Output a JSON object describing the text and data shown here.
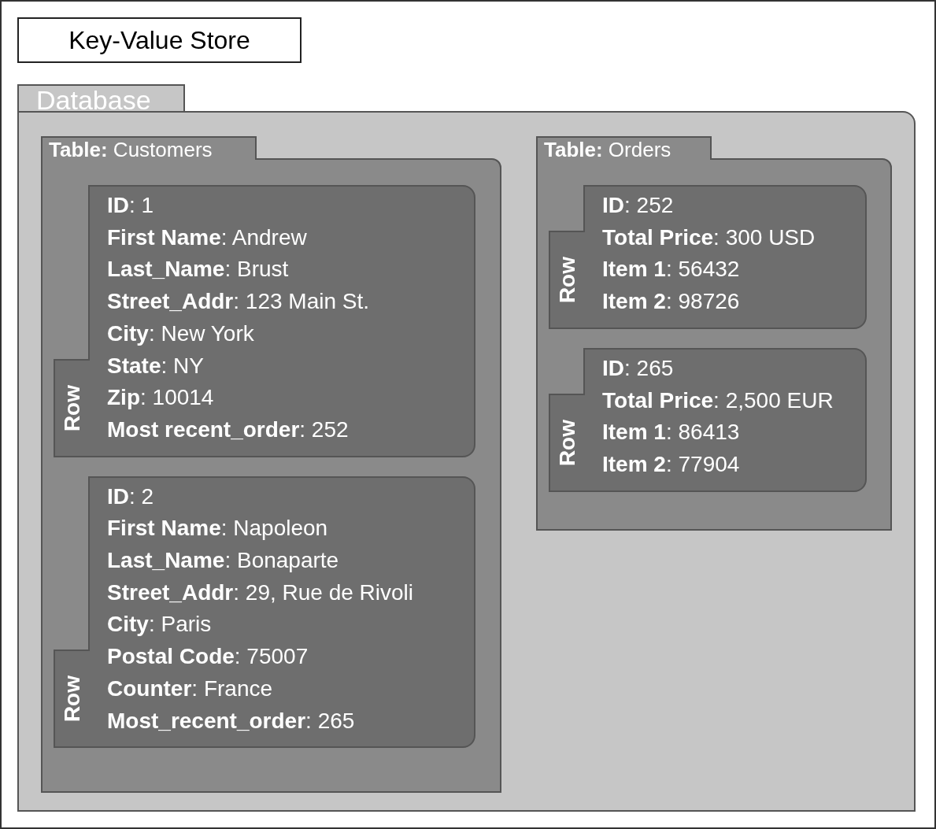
{
  "title": "Key-Value Store",
  "database": {
    "label": "Database",
    "tables": [
      {
        "label": "**Table:** Customers",
        "rows": [
          {
            "tab": "Row",
            "fields": [
              "**ID**: 1",
              "**First Name**: Andrew",
              "**Last_Name**: Brust",
              "**Street_Addr**: 123 Main St.",
              "**City**: New York",
              "**State**: NY",
              "**Zip**: 10014",
              "**Most recent_order**: 252"
            ]
          },
          {
            "tab": "Row",
            "fields": [
              "**ID**: 2",
              "**First Name**: Napoleon",
              "**Last_Name**: Bonaparte",
              "**Street_Addr**: 29, Rue de Rivoli",
              "**City**: Paris",
              "**Postal Code**: 75007",
              "**Counter**: France",
              "**Most_recent_order**: 265"
            ]
          }
        ]
      },
      {
        "label": "**Table:** Orders",
        "rows": [
          {
            "tab": "Row",
            "fields": [
              "**ID**: 252",
              "**Total Price**: 300 USD",
              "**Item 1**: 56432",
              "**Item 2**: 98726"
            ]
          },
          {
            "tab": "Row",
            "fields": [
              "**ID**: 265",
              "**Total Price**: 2,500 EUR",
              "**Item 1**: 86413",
              "**Item 2**: 77904"
            ]
          }
        ]
      }
    ]
  }
}
